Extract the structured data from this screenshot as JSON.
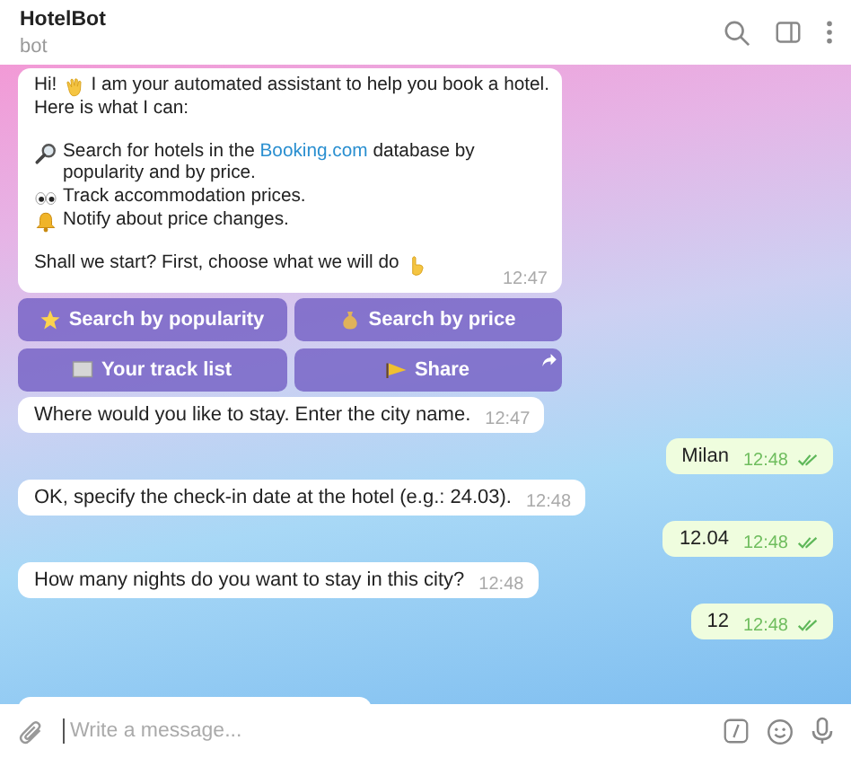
{
  "header": {
    "title": "HotelBot",
    "subtitle": "bot"
  },
  "messages": [
    {
      "kind": "incoming",
      "paragraphs": [
        [
          {
            "segments": [
              {
                "kind": "text",
                "text": "Hi!"
              },
              {
                "kind": "wave"
              },
              {
                "kind": "text",
                "text": "I am your automated assistant to help you book a hotel."
              }
            ]
          },
          {
            "segments": [
              {
                "kind": "text",
                "text": "Here is what I can:"
              }
            ]
          }
        ],
        [
          {
            "segments": [
              {
                "kind": "magnifier"
              },
              {
                "kind": "text",
                "text": "Search for hotels in the ",
                "link": "Booking.com",
                "after": " database by popularity and by price."
              }
            ]
          },
          {
            "segments": [
              {
                "kind": "eyes"
              },
              {
                "kind": "text",
                "text": "Track accommodation prices."
              }
            ]
          },
          {
            "segments": [
              {
                "kind": "bell"
              },
              {
                "kind": "text",
                "text": "Notify about price changes."
              }
            ]
          }
        ],
        [
          {
            "segments": [
              {
                "kind": "text",
                "text": "Shall we start? First, choose what we will do"
              },
              {
                "kind": "pointing"
              }
            ]
          }
        ]
      ],
      "time": "12:47",
      "keyboard": [
        [
          {
            "label": "Search by popularity",
            "kind": "star",
            "shares": false
          },
          {
            "label": "Search by price",
            "kind": "moneybag",
            "shares": false
          }
        ],
        [
          {
            "label": "Your track list",
            "kind": "screen",
            "shares": false
          },
          {
            "label": "Share",
            "kind": "flag",
            "shares": true
          }
        ]
      ]
    },
    {
      "kind": "incoming",
      "text": "Where would you like to stay. Enter the city name.",
      "time": "12:47"
    },
    {
      "kind": "outgoing",
      "text": "Milan",
      "time": "12:48",
      "read": true
    },
    {
      "kind": "incoming",
      "text": "OK, specify the check-in date at the hotel (e.g.: 24.03).",
      "time": "12:48"
    },
    {
      "kind": "outgoing",
      "text": "12.04",
      "time": "12:48",
      "read": true
    },
    {
      "kind": "incoming",
      "text": "How many nights do you want to stay in this city?",
      "time": "12:48"
    },
    {
      "kind": "outgoing",
      "text": "12",
      "time": "12:48",
      "read": true
    }
  ],
  "composer": {
    "placeholder": "Write a message..."
  }
}
